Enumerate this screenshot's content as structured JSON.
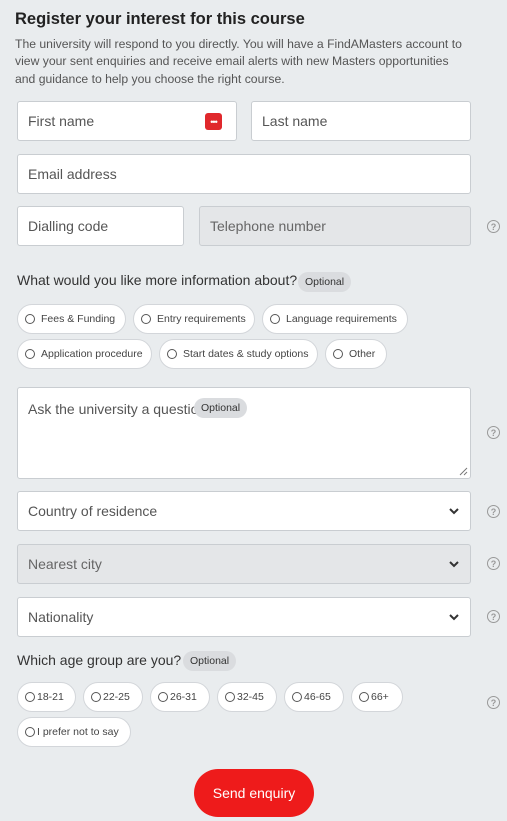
{
  "title": "Register your interest for this course",
  "intro": "The university will respond to you directly. You will have a FindAMasters account to view your sent enquiries and receive email alerts with new Masters opportunities and guidance to help you choose the right course.",
  "fields": {
    "first_name": "First name",
    "last_name": "Last name",
    "email": "Email address",
    "dialling_code": "Dialling code",
    "telephone": "Telephone number"
  },
  "info_question": {
    "label": "What would you like more information about?",
    "optional": "Optional",
    "options": [
      "Fees & Funding",
      "Entry requirements",
      "Language requirements",
      "Application procedure",
      "Start dates & study options",
      "Other"
    ]
  },
  "question_box": {
    "placeholder": "Ask the university a question",
    "optional": "Optional"
  },
  "selects": {
    "country": "Country of residence",
    "city": "Nearest city",
    "nationality": "Nationality"
  },
  "age_question": {
    "label": "Which age group are you?",
    "optional": "Optional",
    "options": [
      "18-21",
      "22-25",
      "26-31",
      "32-45",
      "46-65",
      "66+",
      "I prefer not to say"
    ]
  },
  "help_symbol": "?",
  "password_manager_icon": "•••",
  "submit_label": "Send enquiry",
  "colors": {
    "background": "#e9ecee",
    "accent": "#ee1b1b",
    "password_icon": "#e0282c"
  }
}
